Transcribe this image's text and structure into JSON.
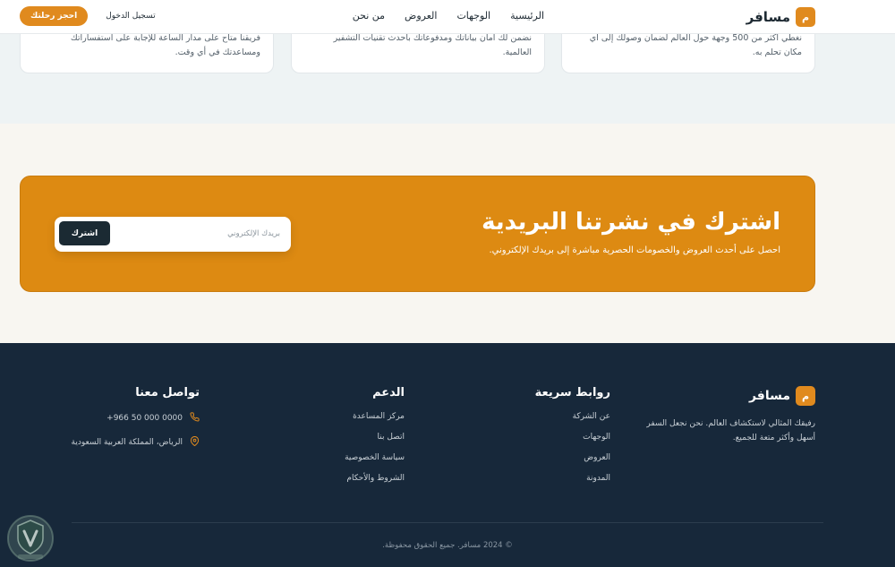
{
  "header": {
    "logo_letter": "م",
    "brand": "مسافر",
    "nav": [
      "الرئيسية",
      "الوجهات",
      "العروض",
      "من نحن"
    ],
    "login_label": "تسجيل الدخول",
    "book_label": "احجز رحلتك"
  },
  "features": {
    "cards": [
      {
        "text": "نغطي أكثر من 500 وجهة حول العالم لضمان وصولك إلى أي مكان تحلم به."
      },
      {
        "text": "نضمن لك أمان بياناتك ومدفوعاتك بأحدث تقنيات التشفير العالمية."
      },
      {
        "text": "فريقنا متاح على مدار الساعة للإجابة على استفساراتك ومساعدتك في أي وقت."
      }
    ]
  },
  "newsletter": {
    "title": "اشترك في نشرتنا البريدية",
    "description": "احصل على أحدث العروض والخصومات الحصرية مباشرة إلى بريدك الإلكتروني.",
    "email_placeholder": "بريدك الإلكتروني",
    "subscribe_label": "اشترك"
  },
  "footer": {
    "logo_letter": "م",
    "brand": "مسافر",
    "about": "رفيقك المثالي لاستكشاف العالم. نحن نجعل السفر أسهل وأكثر متعة للجميع.",
    "quick_links": {
      "title": "روابط سريعة",
      "items": [
        "عن الشركة",
        "الوجهات",
        "العروض",
        "المدونة"
      ]
    },
    "support": {
      "title": "الدعم",
      "items": [
        "مركز المساعدة",
        "اتصل بنا",
        "سياسة الخصوصية",
        "الشروط والأحكام"
      ]
    },
    "contact": {
      "title": "تواصل معنا",
      "phone": "+966 50 000 0000",
      "address": "الرياض، المملكة العربية السعودية"
    },
    "copyright": "© 2024 مسافر. جميع الحقوق محفوظة."
  },
  "colors": {
    "accent": "#e08a1e",
    "newsletter_bg": "#dd8a12",
    "footer_bg": "#17283a",
    "features_bg": "#eef3f4"
  },
  "icons": {
    "phone": "phone-icon",
    "location": "location-pin-icon"
  }
}
